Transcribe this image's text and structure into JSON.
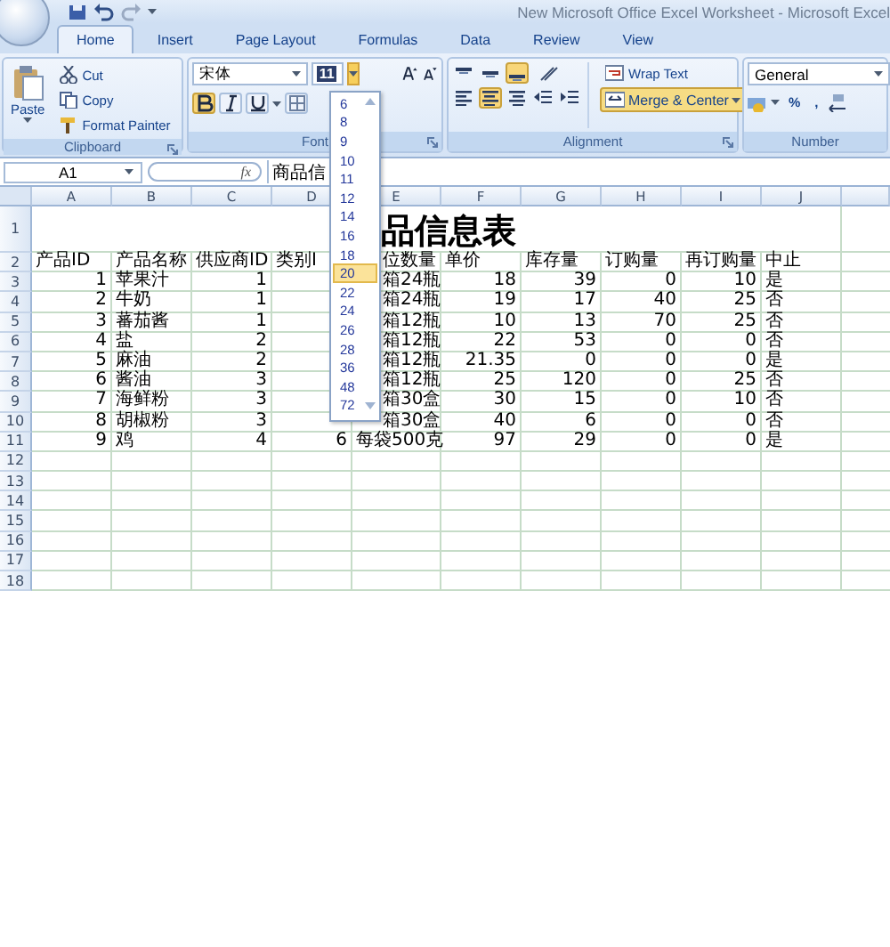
{
  "window": {
    "title": "New Microsoft Office Excel Worksheet - Microsoft Excel"
  },
  "tabs": [
    {
      "label": "Home",
      "selected": true
    },
    {
      "label": "Insert",
      "selected": false
    },
    {
      "label": "Page Layout",
      "selected": false
    },
    {
      "label": "Formulas",
      "selected": false
    },
    {
      "label": "Data",
      "selected": false
    },
    {
      "label": "Review",
      "selected": false
    },
    {
      "label": "View",
      "selected": false
    }
  ],
  "clipboard": {
    "paste": "Paste",
    "cut": "Cut",
    "copy": "Copy",
    "format_painter": "Format Painter",
    "label": "Clipboard"
  },
  "font": {
    "name": "宋体",
    "size": "11",
    "bold": true,
    "italic": false,
    "underline": false,
    "label": "Font"
  },
  "alignment": {
    "vertical": [
      {
        "kind": "top",
        "selected": false
      },
      {
        "kind": "middle",
        "selected": false
      },
      {
        "kind": "bottom",
        "selected": true
      }
    ],
    "horizontal": [
      {
        "kind": "left",
        "selected": false
      },
      {
        "kind": "center",
        "selected": true
      },
      {
        "kind": "right",
        "selected": false
      }
    ],
    "wrap_text": "Wrap Text",
    "merge_center": "Merge & Center",
    "merge_center_on": true,
    "label": "Alignment"
  },
  "number": {
    "format": "General",
    "percent": "%",
    "comma": ",",
    "label": "Number"
  },
  "formula_bar": {
    "name_box": "A1",
    "fx": "fx",
    "value": "商品信"
  },
  "sheet": {
    "columns": [
      {
        "letter": "A",
        "numeric": true
      },
      {
        "letter": "B",
        "numeric": false
      },
      {
        "letter": "C",
        "numeric": true
      },
      {
        "letter": "D",
        "numeric": true
      },
      {
        "letter": "E",
        "numeric": false
      },
      {
        "letter": "F",
        "numeric": true
      },
      {
        "letter": "G",
        "numeric": true
      },
      {
        "letter": "H",
        "numeric": true
      },
      {
        "letter": "I",
        "numeric": true
      },
      {
        "letter": "J",
        "numeric": false
      }
    ],
    "title_row": {
      "header": "1",
      "title": "品信息表"
    },
    "rows": [
      {
        "header": "2",
        "kind": "header",
        "cells": [
          "产品ID",
          "产品名称",
          "供应商ID",
          "类别I",
          "位数量",
          "单价",
          "库存量",
          "订购量",
          "再订购量",
          "中止"
        ]
      },
      {
        "header": "3",
        "kind": "data",
        "cells": [
          "1",
          "苹果汁",
          "1",
          null,
          "箱24瓶",
          "18",
          "39",
          "0",
          "10",
          "是"
        ]
      },
      {
        "header": "4",
        "kind": "data",
        "cells": [
          "2",
          "牛奶",
          "1",
          null,
          "箱24瓶",
          "19",
          "17",
          "40",
          "25",
          "否"
        ]
      },
      {
        "header": "5",
        "kind": "data",
        "cells": [
          "3",
          "蕃茄酱",
          "1",
          null,
          "箱12瓶",
          "10",
          "13",
          "70",
          "25",
          "否"
        ]
      },
      {
        "header": "6",
        "kind": "data",
        "cells": [
          "4",
          "盐",
          "2",
          null,
          "箱12瓶",
          "22",
          "53",
          "0",
          "0",
          "否"
        ]
      },
      {
        "header": "7",
        "kind": "data",
        "cells": [
          "5",
          "麻油",
          "2",
          null,
          "箱12瓶",
          "21.35",
          "0",
          "0",
          "0",
          "是"
        ]
      },
      {
        "header": "8",
        "kind": "data",
        "cells": [
          "6",
          "酱油",
          "3",
          null,
          "箱12瓶",
          "25",
          "120",
          "0",
          "25",
          "否"
        ]
      },
      {
        "header": "9",
        "kind": "data",
        "cells": [
          "7",
          "海鲜粉",
          "3",
          null,
          "箱30盒",
          "30",
          "15",
          "0",
          "10",
          "否"
        ]
      },
      {
        "header": "10",
        "kind": "data",
        "cells": [
          "8",
          "胡椒粉",
          "3",
          null,
          "箱30盒",
          "40",
          "6",
          "0",
          "0",
          "否"
        ]
      },
      {
        "header": "11",
        "kind": "data",
        "cells": [
          "9",
          "鸡",
          "4",
          "6",
          "每袋500克",
          "97",
          "29",
          "0",
          "0",
          "是"
        ]
      },
      {
        "header": "12",
        "kind": "data",
        "cells": []
      },
      {
        "header": "13",
        "kind": "data",
        "cells": []
      },
      {
        "header": "14",
        "kind": "data",
        "cells": []
      },
      {
        "header": "15",
        "kind": "data",
        "cells": []
      },
      {
        "header": "16",
        "kind": "data",
        "cells": []
      },
      {
        "header": "17",
        "kind": "data",
        "cells": []
      },
      {
        "header": "18",
        "kind": "data",
        "cells": []
      }
    ]
  },
  "size_dropdown": {
    "options": [
      {
        "label": "6",
        "selected": false
      },
      {
        "label": "8",
        "selected": false
      },
      {
        "label": "9",
        "selected": false
      },
      {
        "label": "10",
        "selected": false
      },
      {
        "label": "11",
        "selected": false
      },
      {
        "label": "12",
        "selected": false
      },
      {
        "label": "14",
        "selected": false
      },
      {
        "label": "16",
        "selected": false
      },
      {
        "label": "18",
        "selected": false
      },
      {
        "label": "20",
        "selected": true
      },
      {
        "label": "22",
        "selected": false
      },
      {
        "label": "24",
        "selected": false
      },
      {
        "label": "26",
        "selected": false
      },
      {
        "label": "28",
        "selected": false
      },
      {
        "label": "36",
        "selected": false
      },
      {
        "label": "48",
        "selected": false
      },
      {
        "label": "72",
        "selected": false
      }
    ]
  }
}
